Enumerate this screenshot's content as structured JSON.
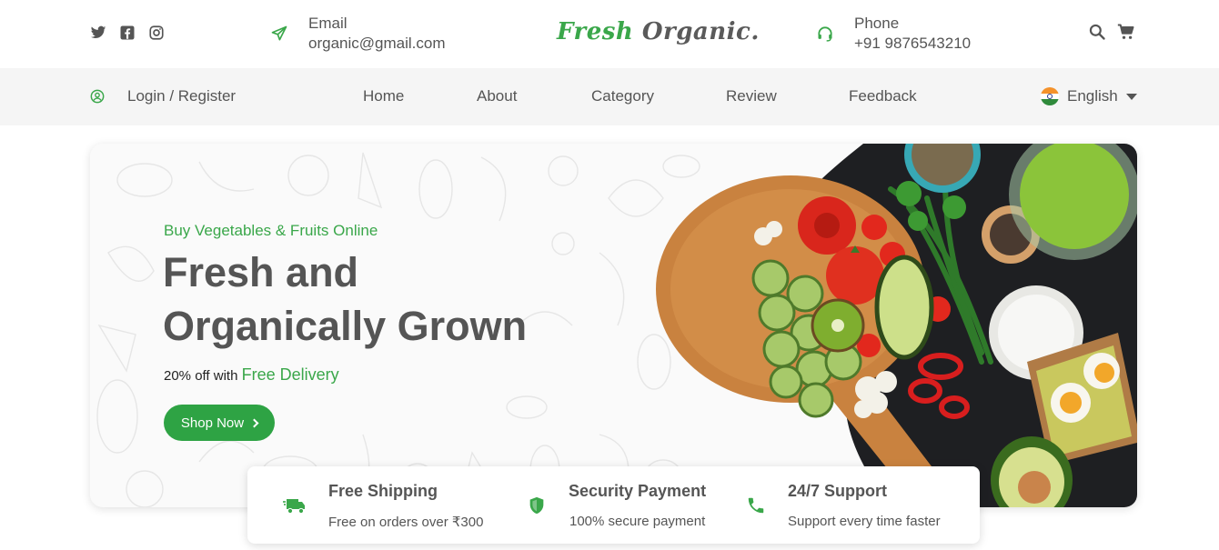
{
  "social": {
    "icons": [
      "twitter-icon",
      "facebook-icon",
      "instagram-icon"
    ]
  },
  "contact": {
    "email_label": "Email",
    "email_value": "organic@gmail.com",
    "phone_label": "Phone",
    "phone_value": "+91 9876543210"
  },
  "logo": {
    "part1": "Fresh",
    "part2": "Organic."
  },
  "nav": {
    "login": "Login / Register",
    "items": [
      "Home",
      "About",
      "Category",
      "Review",
      "Feedback"
    ],
    "language": "English"
  },
  "hero": {
    "subtitle": "Buy Vegetables & Fruits Online",
    "title_line1": "Fresh and",
    "title_line2": "Organically Grown",
    "offer_prefix": "20% off with",
    "offer_highlight": "Free Delivery",
    "cta": "Shop Now"
  },
  "features": [
    {
      "title": "Free Shipping",
      "desc": "Free on orders over ₹300",
      "icon": "truck-icon"
    },
    {
      "title": "Security Payment",
      "desc": "100% secure payment",
      "icon": "shield-icon"
    },
    {
      "title": "24/7 Support",
      "desc": "Support every time faster",
      "icon": "phone-icon"
    }
  ],
  "colors": {
    "brand_green": "#3aa74a",
    "button_green": "#2ea344",
    "text": "#555555",
    "nav_bg": "#f5f5f5"
  }
}
